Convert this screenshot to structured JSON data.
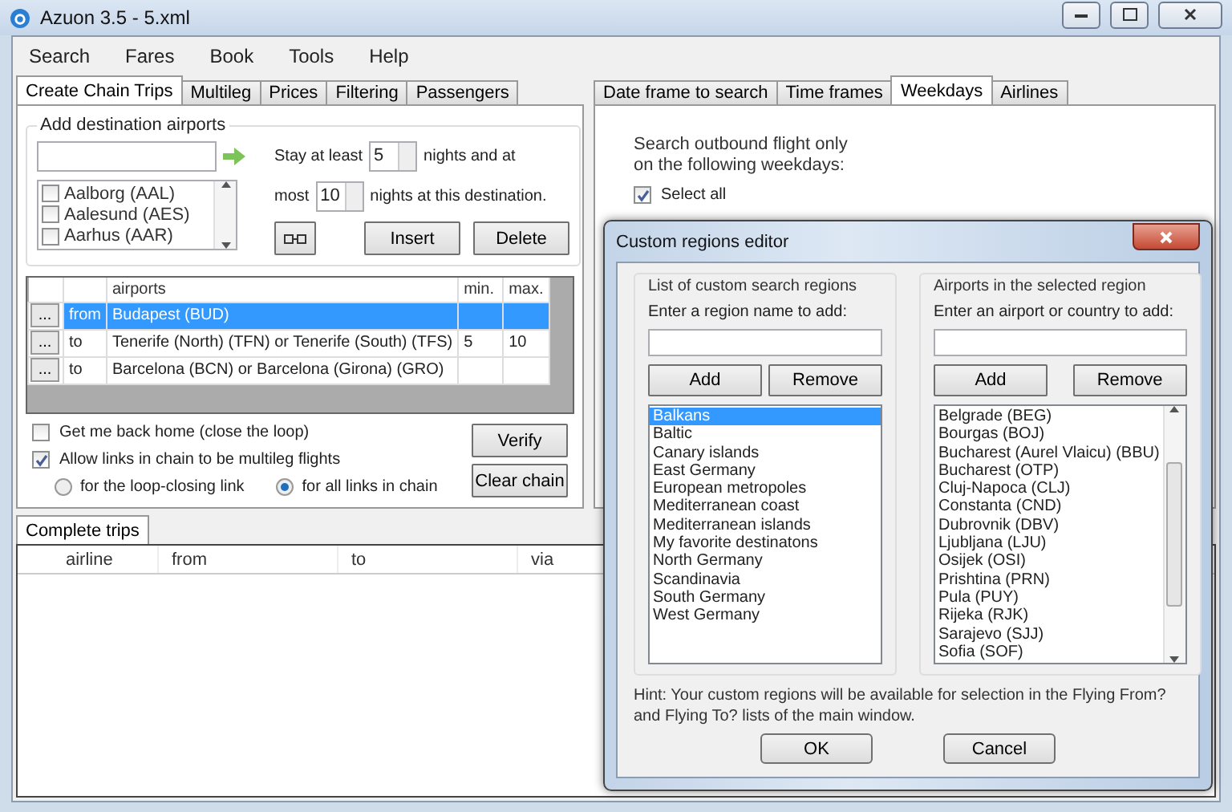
{
  "window": {
    "title": "Azuon 3.5 - 5.xml"
  },
  "menu": [
    "Search",
    "Fares",
    "Book",
    "Tools",
    "Help"
  ],
  "left_tabs": [
    {
      "label": "Create Chain Trips",
      "selected": true
    },
    {
      "label": "Multileg",
      "selected": false
    },
    {
      "label": "Prices",
      "selected": false
    },
    {
      "label": "Filtering",
      "selected": false
    },
    {
      "label": "Passengers",
      "selected": false
    }
  ],
  "destination_group": {
    "title": "Add destination airports",
    "airports": [
      {
        "label": "Aalborg (AAL)",
        "checked": false
      },
      {
        "label": "Aalesund (AES)",
        "checked": false
      },
      {
        "label": "Aarhus (AAR)",
        "checked": false
      }
    ],
    "stay_prefix": "Stay at least",
    "min_nights": "5",
    "stay_middle": "nights and at",
    "most_label": "most",
    "max_nights": "10",
    "max_suffix": "nights at this destination.",
    "buttons": [
      "Insert",
      "Delete"
    ]
  },
  "chain_table": {
    "columns": [
      "airports",
      "min.",
      "max."
    ],
    "rows": [
      {
        "button": "...",
        "direction": "from",
        "airports": "Budapest (BUD)",
        "selected": true
      },
      {
        "button": "...",
        "direction": "to",
        "airports": "Tenerife (North) (TFN) or Tenerife (South) (TFS)",
        "min": "5",
        "max": "10",
        "selected": false
      },
      {
        "button": "...",
        "direction": "to",
        "airports": "Barcelona (BCN) or Barcelona (Girona) (GRO)",
        "selected": false
      }
    ]
  },
  "options": {
    "checkboxes": [
      {
        "label": "Get me back home (close the loop)",
        "checked": false
      },
      {
        "label": "Allow links in chain to be multileg flights",
        "checked": true
      }
    ],
    "radios": [
      {
        "label": "for the loop-closing link",
        "selected": false
      },
      {
        "label": "for all links in chain",
        "selected": true
      }
    ],
    "buttons": [
      "Verify",
      "Clear chain"
    ]
  },
  "right_tabs": [
    {
      "label": "Date frame to search",
      "selected": false
    },
    {
      "label": "Time frames",
      "selected": false
    },
    {
      "label": "Weekdays",
      "selected": true
    },
    {
      "label": "Airlines",
      "selected": false
    }
  ],
  "weekdays": {
    "prompt": "Search outbound flight only\non the following weekdays:",
    "select_all": {
      "label": "Select all",
      "checked": true
    }
  },
  "results": {
    "tabs": [
      {
        "label": "Complete trips",
        "selected": true
      }
    ],
    "columns": [
      "airline",
      "from",
      "to",
      "via"
    ]
  },
  "dialog": {
    "title": "Custom regions editor",
    "regions": {
      "title": "List of custom search regions",
      "field_label": "Enter a region name to add:",
      "buttons": [
        "Add",
        "Remove"
      ],
      "items": [
        {
          "label": "Balkans",
          "selected": true
        },
        {
          "label": "Baltic",
          "selected": false
        },
        {
          "label": "Canary islands",
          "selected": false
        },
        {
          "label": "East Germany",
          "selected": false
        },
        {
          "label": "European metropoles",
          "selected": false
        },
        {
          "label": "Mediterranean coast",
          "selected": false
        },
        {
          "label": "Mediterranean islands",
          "selected": false
        },
        {
          "label": "My favorite destinatons",
          "selected": false
        },
        {
          "label": "North Germany",
          "selected": false
        },
        {
          "label": "Scandinavia",
          "selected": false
        },
        {
          "label": "South Germany",
          "selected": false
        },
        {
          "label": "West Germany",
          "selected": false
        }
      ]
    },
    "airports": {
      "title": "Airports in the selected region",
      "field_label": "Enter an airport or country to add:",
      "buttons": [
        "Add",
        "Remove"
      ],
      "items": [
        {
          "label": "Belgrade (BEG)",
          "selected": false
        },
        {
          "label": "Bourgas (BOJ)",
          "selected": false
        },
        {
          "label": "Bucharest (Aurel Vlaicu) (BBU)",
          "selected": false
        },
        {
          "label": "Bucharest (OTP)",
          "selected": false
        },
        {
          "label": "Cluj-Napoca (CLJ)",
          "selected": false
        },
        {
          "label": "Constanta (CND)",
          "selected": false
        },
        {
          "label": "Dubrovnik (DBV)",
          "selected": false
        },
        {
          "label": "Ljubljana (LJU)",
          "selected": false
        },
        {
          "label": "Osijek (OSI)",
          "selected": false
        },
        {
          "label": "Prishtina (PRN)",
          "selected": false
        },
        {
          "label": "Pula (PUY)",
          "selected": false
        },
        {
          "label": "Rijeka (RJK)",
          "selected": false
        },
        {
          "label": "Sarajevo (SJJ)",
          "selected": false
        },
        {
          "label": "Sofia (SOF)",
          "selected": false
        }
      ]
    },
    "hint": "Hint: Your custom regions will be available for selection in the Flying From? and Flying To? lists of the main window.",
    "buttons": [
      "OK",
      "Cancel"
    ]
  }
}
